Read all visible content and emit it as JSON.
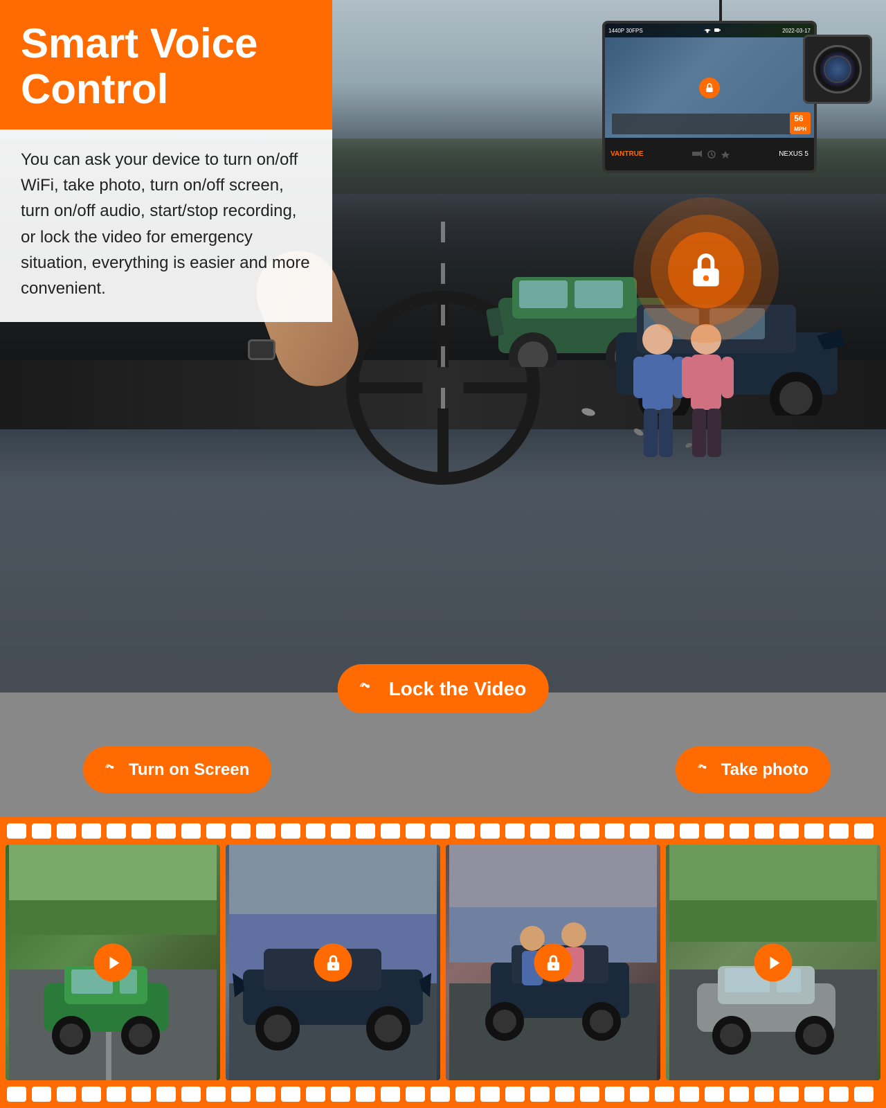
{
  "page": {
    "title": "Smart Voice Control - Vantrue Nexus 5",
    "bg_color": "#888888",
    "accent_color": "#FF6B00"
  },
  "header": {
    "title_line1": "Smart Voice",
    "title_line2": "Control",
    "description": "You can ask your device to turn on/off WiFi, take photo, turn on/off screen, turn on/off audio, start/stop recording, or lock the video for emergency situation, everything is easier and more convenient."
  },
  "dashcam": {
    "model": "NEXUS 5",
    "brand": "VANTRUE",
    "resolution": "1440P 30FPS",
    "speed": "56",
    "speed_unit": "MPH"
  },
  "voice_commands": {
    "command1": "Lock the Video",
    "command2": "Turn on Screen",
    "command3": "Take photo",
    "voice_symbol": "((·"
  },
  "filmstrip": {
    "frames": [
      {
        "id": 1,
        "type": "play",
        "has_icon": true,
        "icon_type": "play"
      },
      {
        "id": 2,
        "type": "lock",
        "has_icon": true,
        "icon_type": "lock"
      },
      {
        "id": 3,
        "type": "lock",
        "has_icon": true,
        "icon_type": "lock"
      },
      {
        "id": 4,
        "type": "play",
        "has_icon": true,
        "icon_type": "play"
      }
    ]
  },
  "icons": {
    "lock": "🔒",
    "play": "▶",
    "voice_wave": "((·"
  }
}
